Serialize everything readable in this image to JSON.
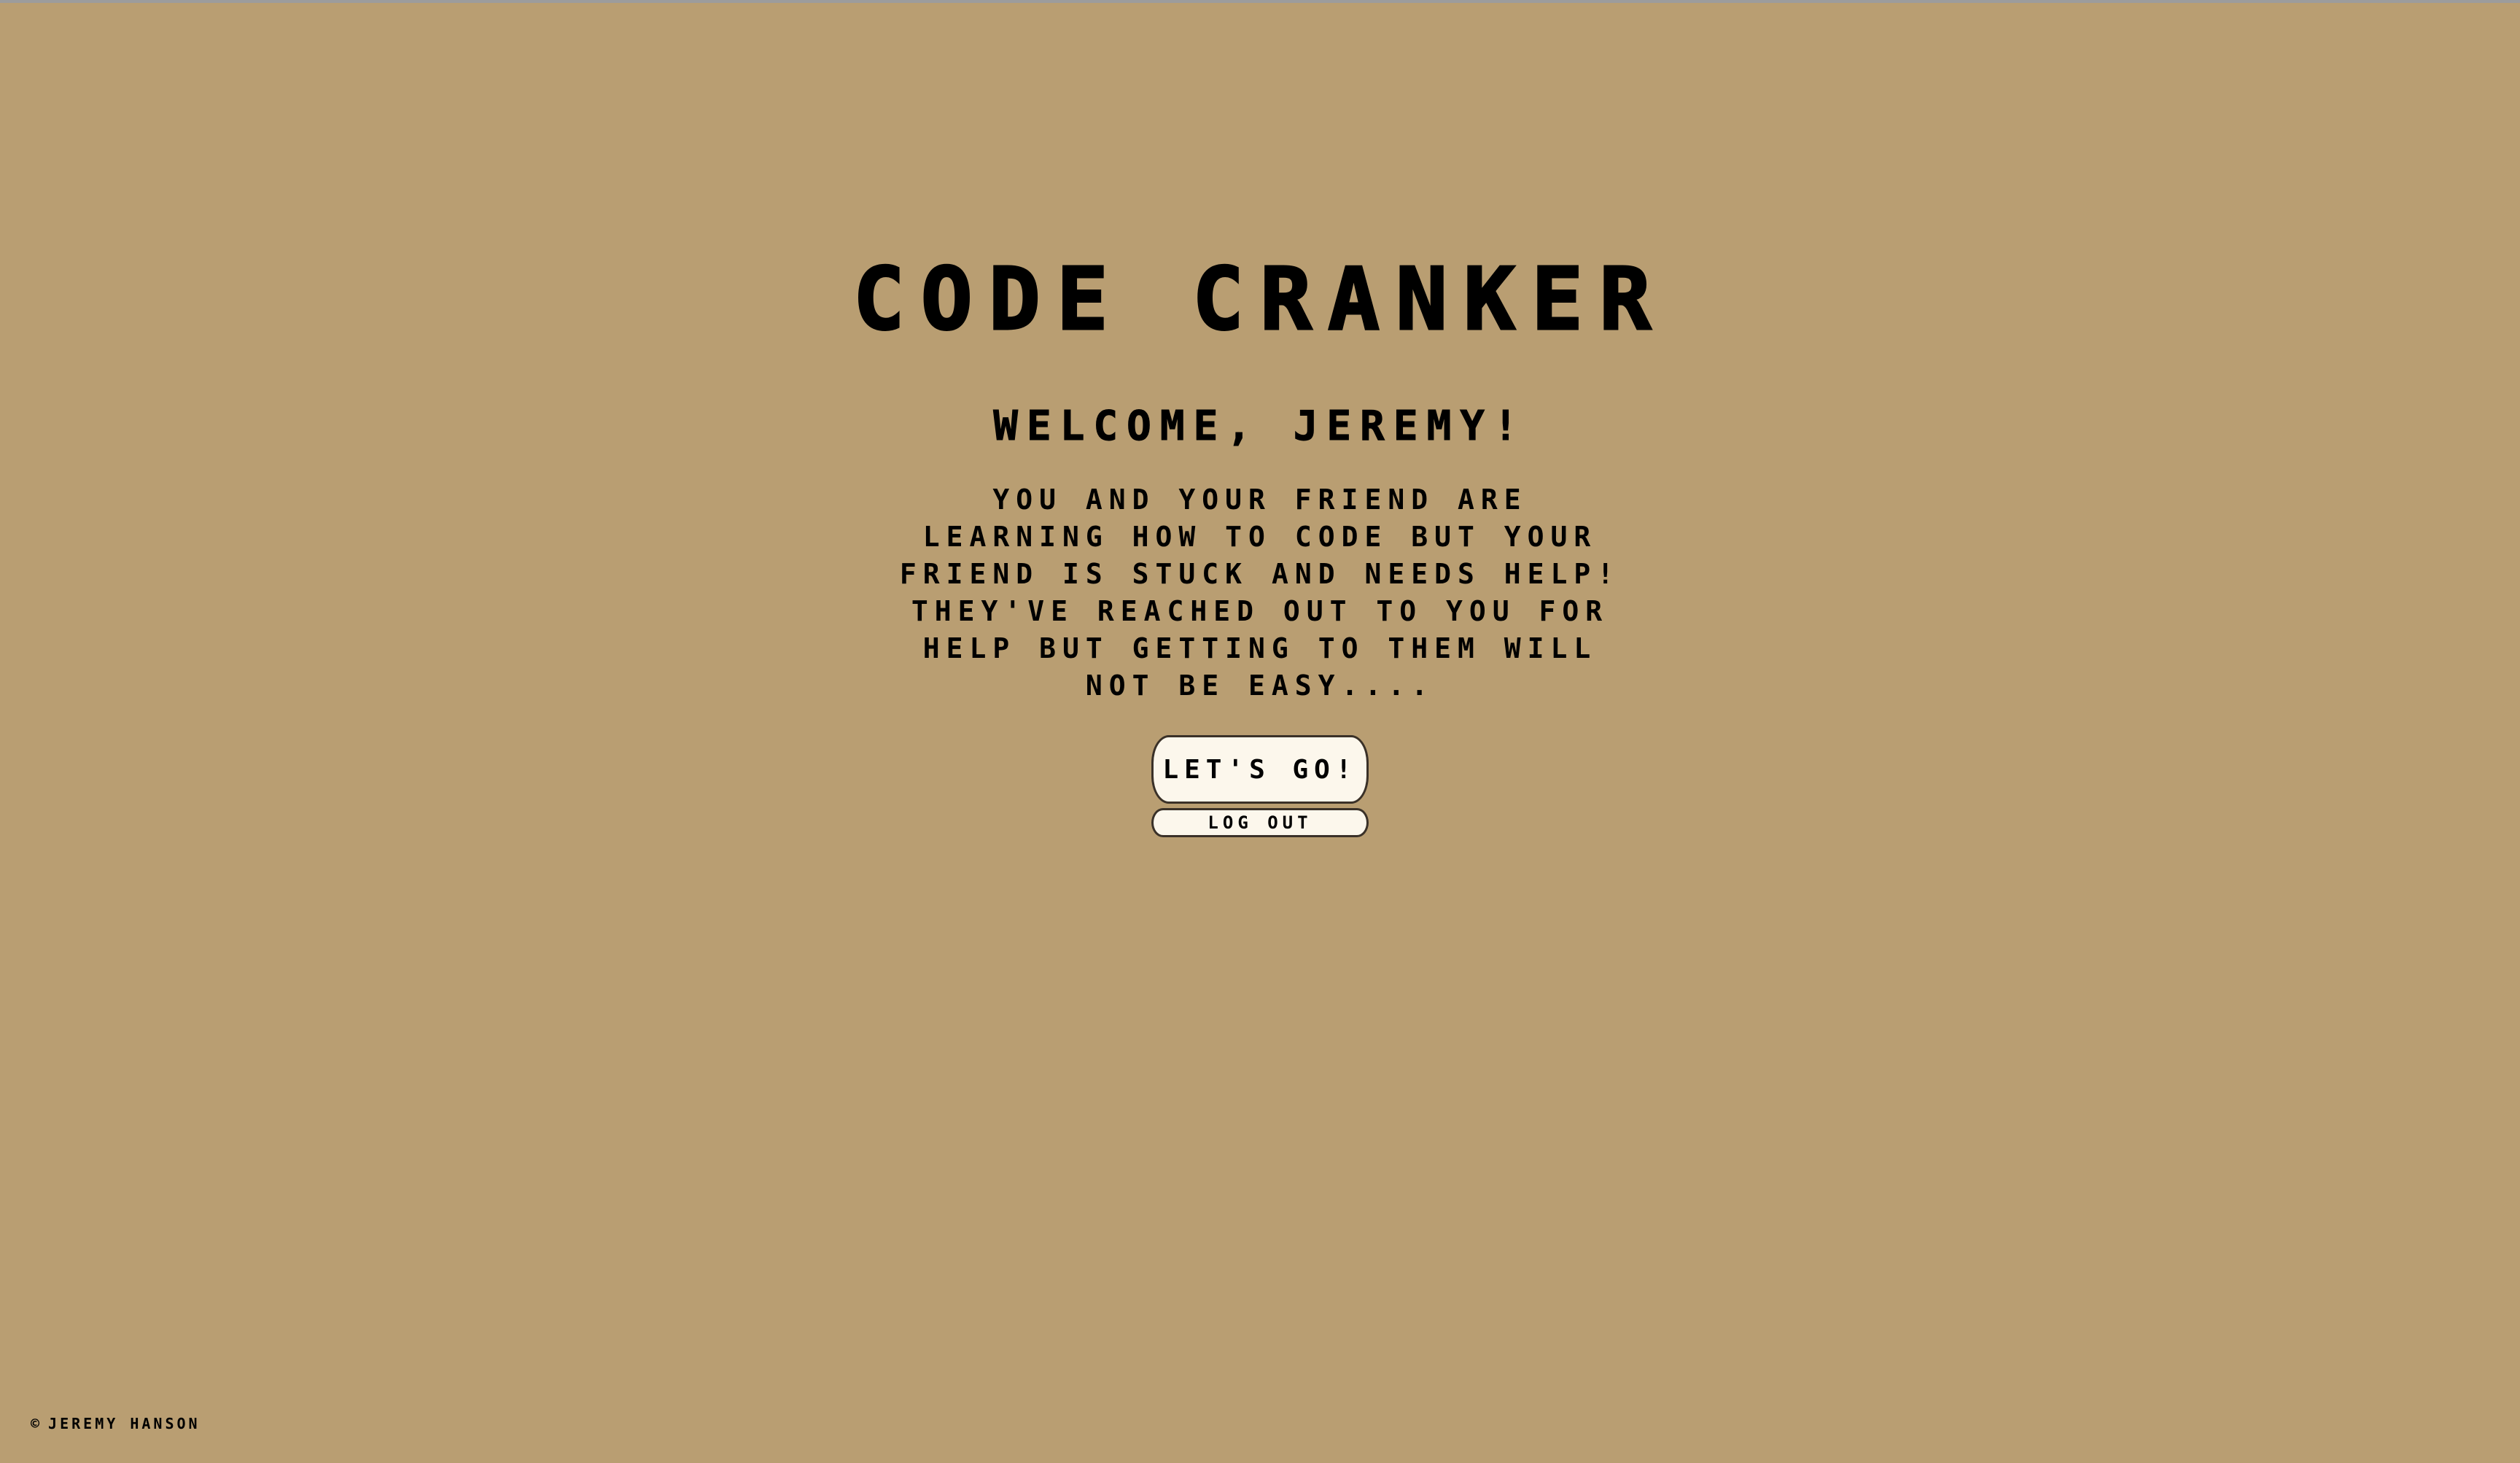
{
  "title": "CODE CRANKER",
  "welcome": "WELCOME, JEREMY!",
  "intro": "YOU AND YOUR FRIEND ARE LEARNING HOW TO CODE BUT YOUR FRIEND IS STUCK AND NEEDS HELP! THEY'VE REACHED OUT TO YOU FOR HELP BUT GETTING TO THEM WILL NOT BE EASY....",
  "buttons": {
    "start_label": "LET'S GO!",
    "logout_label": "LOG OUT"
  },
  "footer": {
    "copyright_symbol": "©",
    "author": "JEREMY HANSON"
  },
  "colors": {
    "background": "#b99e72",
    "button_fill": "#fcf7ec",
    "text": "#000000"
  }
}
